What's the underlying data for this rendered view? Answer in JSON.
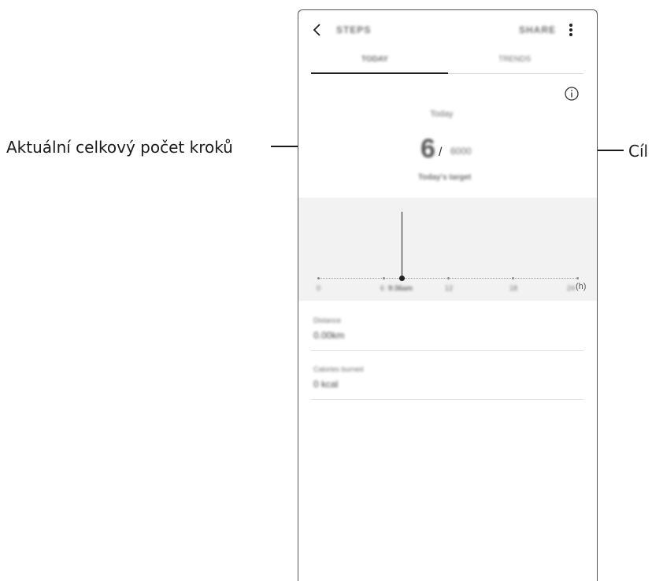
{
  "callouts": {
    "left_label": "Aktuální celkový počet kroků",
    "right_label": "Cíl"
  },
  "app": {
    "title": "STEPS",
    "action": "SHARE",
    "tabs": [
      "TODAY",
      "TRENDS"
    ],
    "active_tab_index": 0
  },
  "summary": {
    "period": "Today",
    "current_steps": "6",
    "separator": "/",
    "goal_steps": "6000",
    "status": "Today's target"
  },
  "chart": {
    "x_ticks": [
      "0",
      "6",
      "12",
      "18",
      "24"
    ],
    "unit_suffix": "(h)",
    "marker_label": "9:36am"
  },
  "stats": [
    {
      "label": "Distance",
      "value": "0.00km"
    },
    {
      "label": "Calories burned",
      "value": "0 kcal"
    }
  ],
  "colors": {
    "background": "#ffffff",
    "chart_background": "#f2f2f2",
    "accent": "#222222"
  }
}
